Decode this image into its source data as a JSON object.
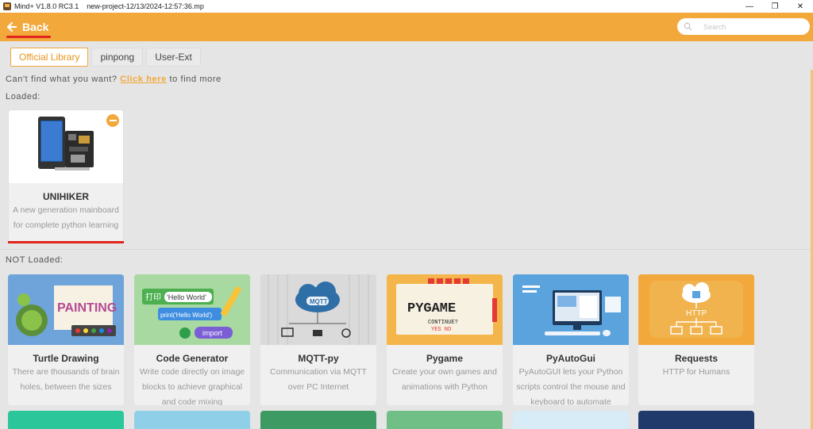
{
  "window": {
    "title": "Mind+ V1.8.0 RC3.1    new-project-12/13/2024-12:57:36.mp",
    "minimize": "—",
    "maximize": "❐",
    "close": "✕"
  },
  "header": {
    "back_label": "Back",
    "search_placeholder": "Search",
    "search_value": ""
  },
  "tabs": [
    {
      "label": "Official Library",
      "active": true
    },
    {
      "label": "pinpong",
      "active": false
    },
    {
      "label": "User-Ext",
      "active": false
    }
  ],
  "find_more": {
    "prefix": "Can't find what you want? ",
    "link": "Click here",
    "suffix": " to find more"
  },
  "loaded_label": "Loaded:",
  "not_loaded_label": "NOT Loaded:",
  "loaded": [
    {
      "name": "UNIHIKER",
      "desc_line1": "A new generation mainboard",
      "desc_line2": "for complete python learning"
    }
  ],
  "not_loaded": [
    {
      "name": "Turtle Drawing",
      "desc_line1": "There are thousands of brain",
      "desc_line2": "holes, between the sizes",
      "desc_line3": "",
      "thumb_text": "PAINTING",
      "thumb_color": "#6fa4db"
    },
    {
      "name": "Code Generator",
      "desc_line1": "Write code directly on image",
      "desc_line2": "blocks to achieve graphical",
      "desc_line3": "and code mixing",
      "thumb_text1": "打印",
      "thumb_text2": "'Hello World'",
      "thumb_text3": "print('Hello World')",
      "thumb_text4": "import",
      "thumb_color": "#a8d9a0"
    },
    {
      "name": "MQTT-py",
      "desc_line1": "Communication via MQTT",
      "desc_line2": "over PC Internet",
      "desc_line3": "",
      "thumb_text": "MQTT",
      "thumb_color": "#d8d8d8"
    },
    {
      "name": "Pygame",
      "desc_line1": "Create your own games and",
      "desc_line2": "animations with Python",
      "desc_line3": "",
      "thumb_text1": "PYGAME",
      "thumb_text2": "CONTINUE?",
      "thumb_text3": "YES  NO",
      "thumb_color": "#f4b64a"
    },
    {
      "name": "PyAutoGui",
      "desc_line1": "PyAutoGUI lets your Python",
      "desc_line2": "scripts control the mouse and",
      "desc_line3": "keyboard to automate",
      "thumb_color": "#5aa3dd"
    },
    {
      "name": "Requests",
      "desc_line1": "HTTP for Humans",
      "desc_line2": "",
      "desc_line3": "",
      "thumb_text": "HTTP",
      "thumb_color": "#f2a83b"
    }
  ],
  "colors": {
    "accent": "#f2a83b",
    "underline_red": "#e0241c",
    "background": "#e5e5e5"
  }
}
